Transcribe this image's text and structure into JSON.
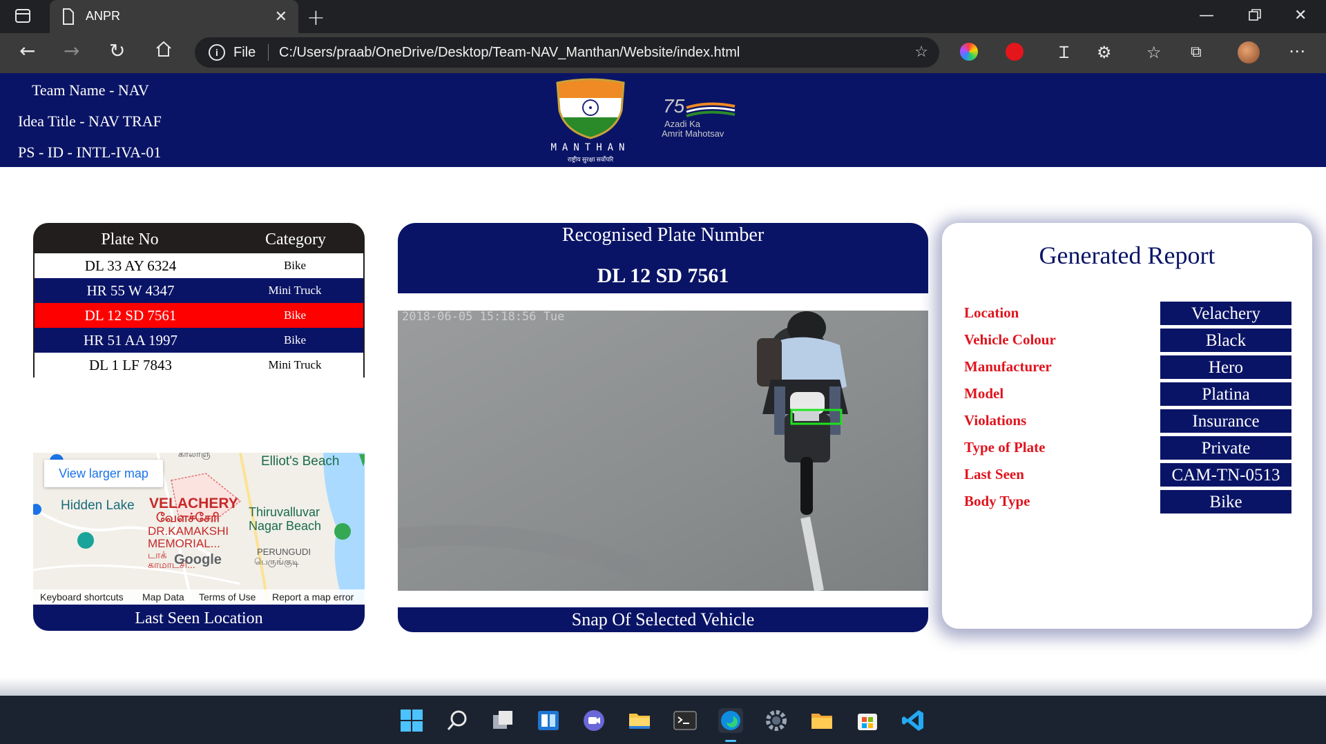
{
  "browser": {
    "tab_title": "ANPR",
    "file_label": "File",
    "url": "C:/Users/praab/OneDrive/Desktop/Team-NAV_Manthan/Website/index.html"
  },
  "header": {
    "team_name": "Team Name - NAV",
    "idea_title": "Idea Title - NAV TRAF",
    "ps_id": "PS - ID - INTL-IVA-01",
    "logo_text": "MANTHAN",
    "logo_sub": "राष्ट्रीय सुरक्षा सर्वोपरि",
    "azadi_75": "75",
    "azadi_line1": "Azadi Ka",
    "azadi_line2": "Amrit Mahotsav"
  },
  "plate_table": {
    "headers": [
      "Plate No",
      "Category"
    ],
    "rows": [
      {
        "plate": "DL 33 AY 6324",
        "category": "Bike",
        "style": "white"
      },
      {
        "plate": "HR 55 W 4347",
        "category": "Mini Truck",
        "style": "navy"
      },
      {
        "plate": "DL 12 SD 7561",
        "category": "Bike",
        "style": "red"
      },
      {
        "plate": "HR 51 AA 1997",
        "category": "Bike",
        "style": "navy"
      },
      {
        "plate": "DL 1 LF 7843",
        "category": "Mini Truck",
        "style": "white"
      }
    ]
  },
  "map": {
    "view_larger": "View larger map",
    "labels": {
      "elliots": "Elliot's Beach",
      "hidden_lake": "Hidden Lake",
      "velachery": "VELACHERY",
      "velachery_ta": "வேளச்சேரி",
      "thiruvalluvar1": "Thiruvalluvar",
      "thiruvalluvar2": "Nagar Beach",
      "kamakshi1": "DR.KAMAKSHI",
      "kamakshi2": "MEMORIAL...",
      "kamakshi3": "டாக்",
      "kamakshi4": "காமாட்சி...",
      "perungudi": "PERUNGUDI",
      "perungudi_ta": "பெருங்குடி",
      "top_cut": "காலாஞ",
      "google": "Google"
    },
    "footer": [
      "Keyboard shortcuts",
      "Map Data",
      "Terms of Use",
      "Report a map error"
    ],
    "caption": "Last Seen Location"
  },
  "recognised": {
    "title": "Recognised Plate Number",
    "plate": "DL 12 SD 7561"
  },
  "snapshot": {
    "timestamp": "2018-06-05 15:18:56 Tue",
    "caption": "Snap Of Selected Vehicle"
  },
  "report": {
    "title": "Generated Report",
    "fields": [
      {
        "label": "Location",
        "value": "Velachery"
      },
      {
        "label": "Vehicle Colour",
        "value": "Black"
      },
      {
        "label": "Manufacturer",
        "value": "Hero"
      },
      {
        "label": "Model",
        "value": "Platina"
      },
      {
        "label": "Violations",
        "value": "Insurance"
      },
      {
        "label": "Type of Plate",
        "value": "Private"
      },
      {
        "label": "Last Seen",
        "value": "CAM-TN-0513"
      },
      {
        "label": "Body Type",
        "value": "Bike"
      }
    ]
  },
  "colors": {
    "navy": "#0a1466",
    "highlight_red": "#ff0000",
    "label_red": "#e0141e",
    "table_header": "#221e1e"
  },
  "taskbar_icons": [
    "windows-start-icon",
    "search-icon",
    "task-view-icon",
    "widgets-icon",
    "chat-icon",
    "file-explorer-icon",
    "terminal-icon",
    "edge-icon",
    "settings-icon",
    "folder-icon",
    "store-icon",
    "vscode-icon"
  ]
}
